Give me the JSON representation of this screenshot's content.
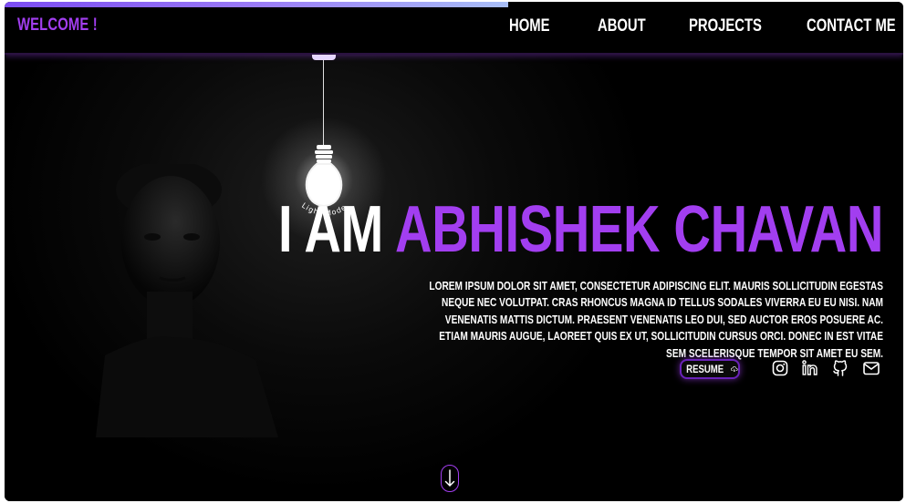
{
  "brand": {
    "label": "WELCOME !"
  },
  "nav": {
    "items": [
      {
        "label": "HOME"
      },
      {
        "label": "ABOUT"
      },
      {
        "label": "PROJECTS"
      },
      {
        "label": "CONTACT ME"
      }
    ]
  },
  "scroll_progress": 0.56,
  "lamp": {
    "label": "Light Mode"
  },
  "hero": {
    "title_prefix": "I AM ",
    "title_name": "ABHISHEK CHAVAN",
    "bio": "Lorem ipsum dolor sit amet, consectetur adipiscing elit. Mauris sollicitudin egestas neque nec volutpat. Cras rhoncus magna id tellus sodales viverra eu eu nisi. Nam venenatis mattis dictum. Praesent venenatis leo dui, sed auctor eros posuere ac. Etiam mauris augue, laoreet quis ex ut, sollicitudin cursus orci. Donec in est vitae sem scelerisque tempor sit amet eu sem.",
    "resume_label": "RESUME"
  },
  "social": [
    "instagram-icon",
    "linkedin-icon",
    "github-icon",
    "mail-icon"
  ],
  "colors": {
    "accent": "#a23ef0",
    "background": "#000000",
    "text": "#ffffff"
  }
}
